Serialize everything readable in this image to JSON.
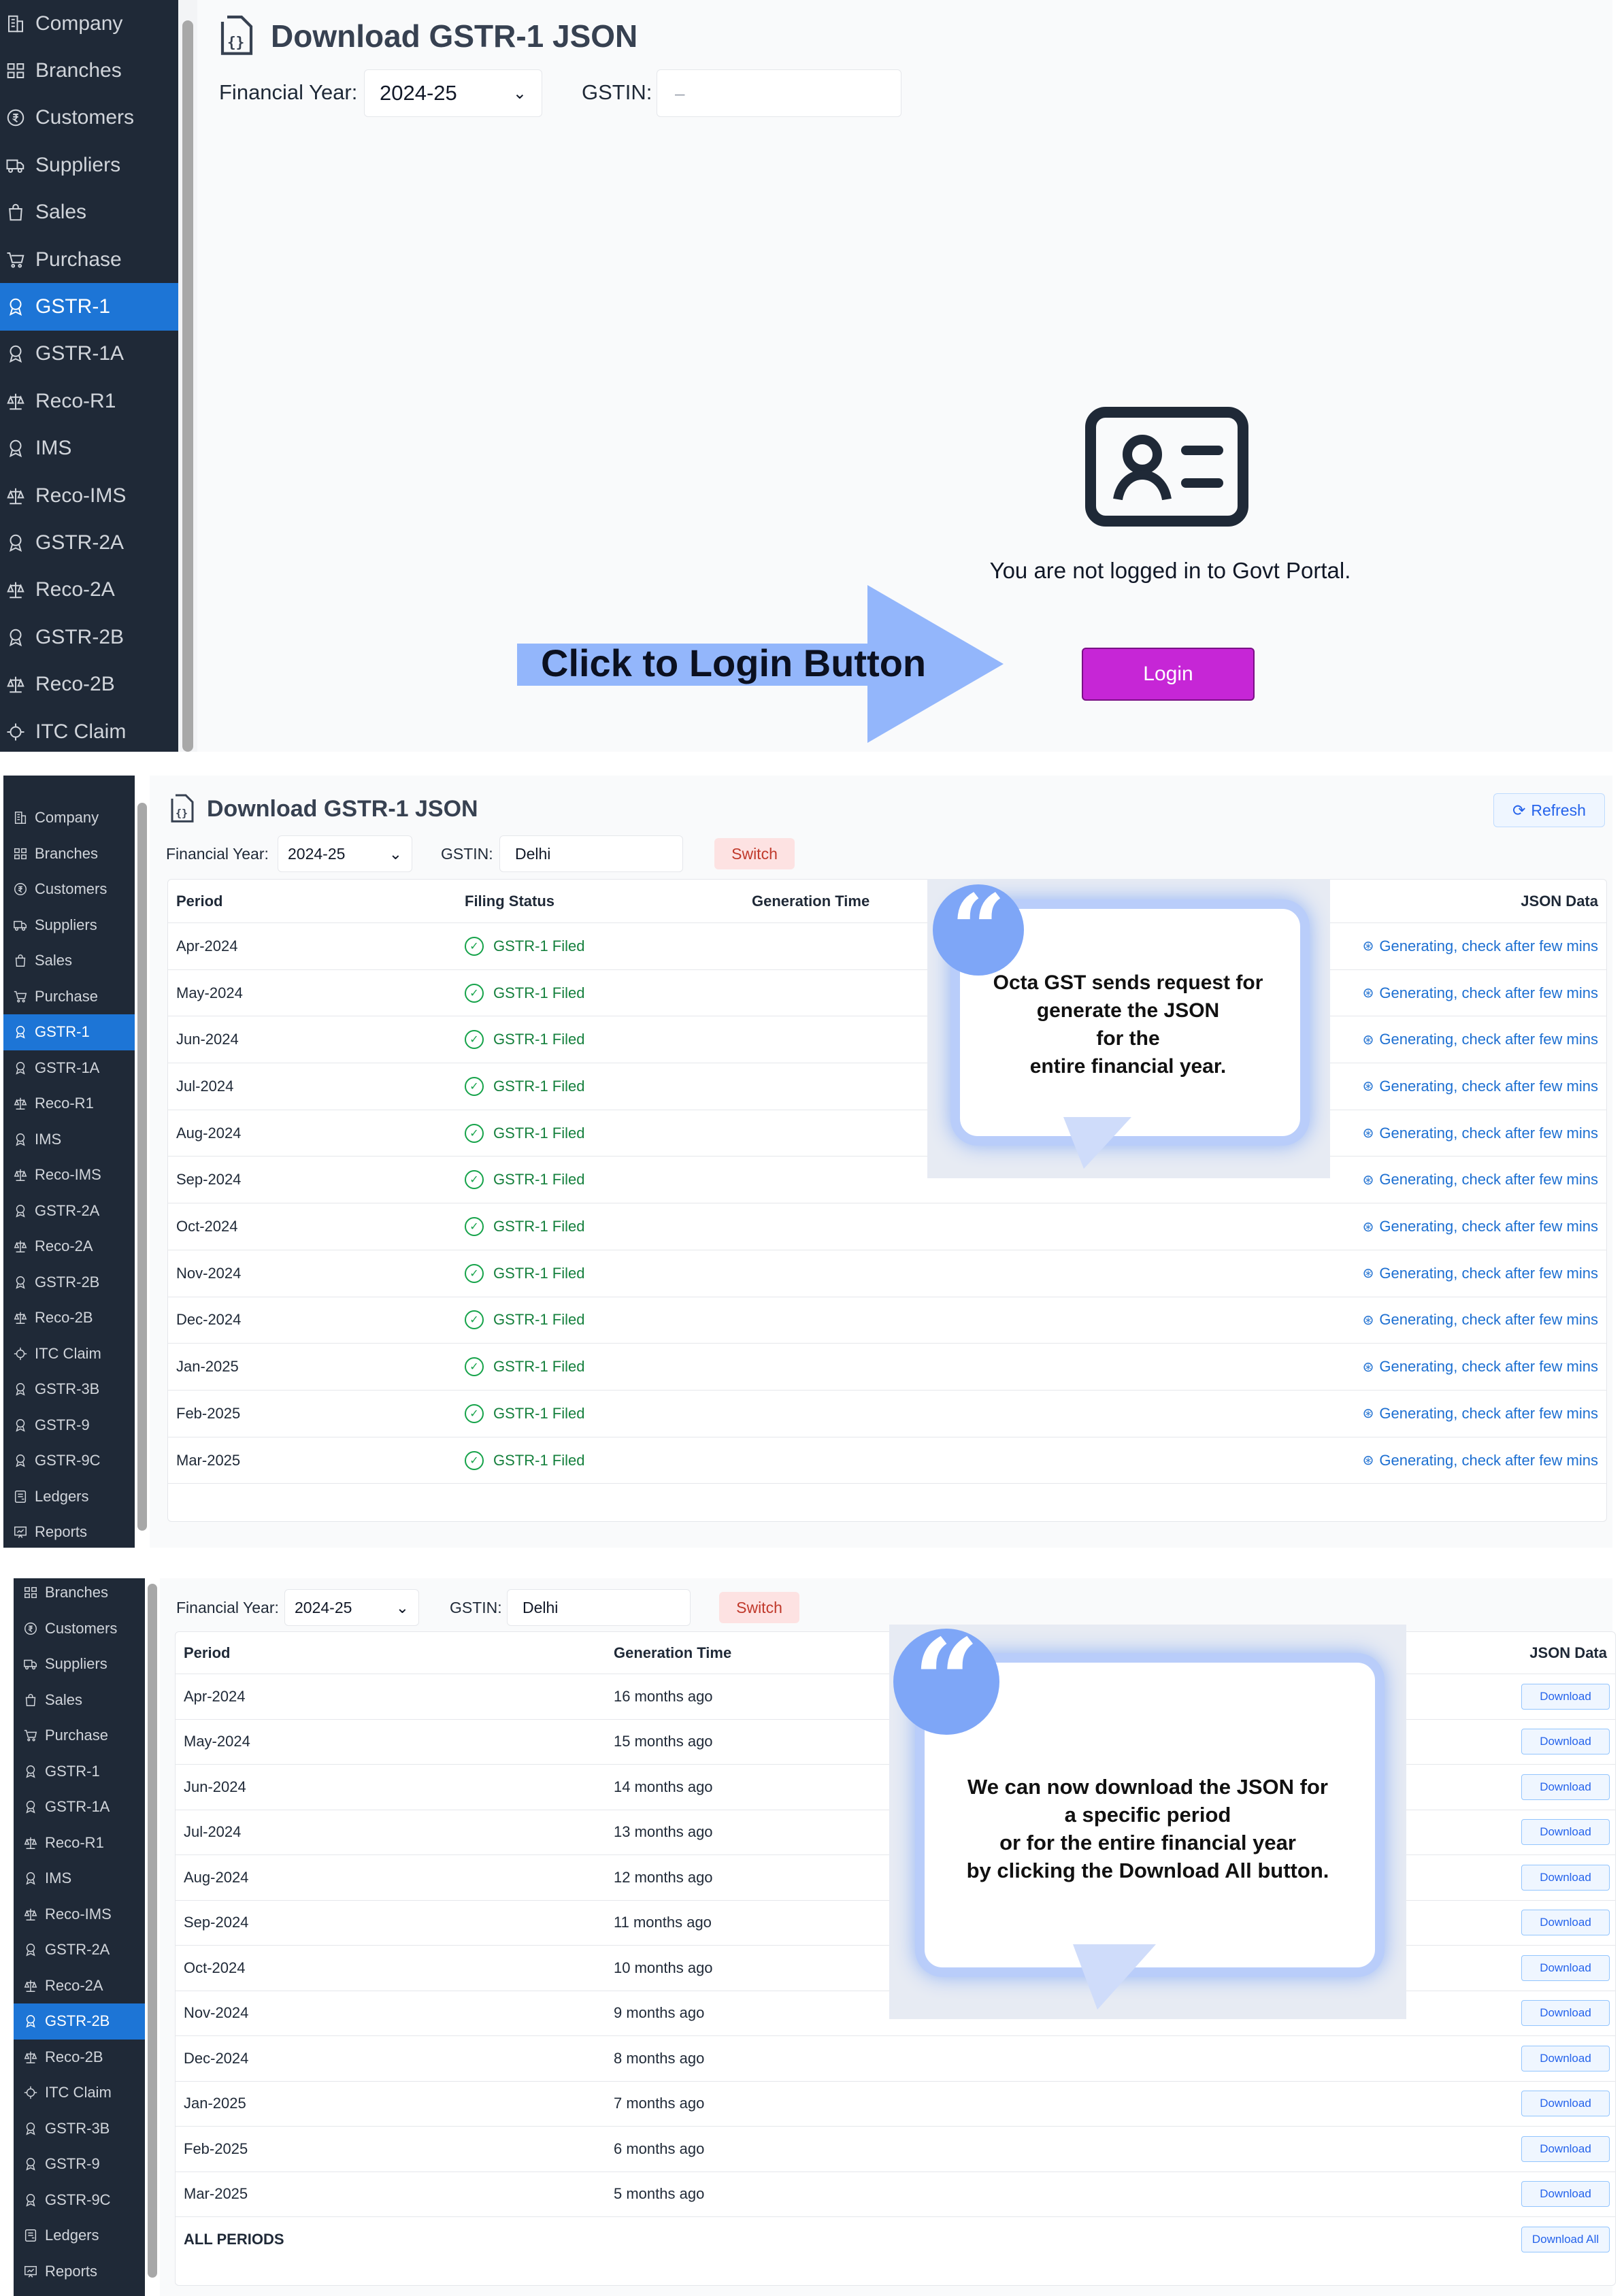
{
  "panel1": {
    "sidebar": [
      "Company",
      "Branches",
      "Customers",
      "Suppliers",
      "Sales",
      "Purchase",
      "GSTR-1",
      "GSTR-1A",
      "Reco-R1",
      "IMS",
      "Reco-IMS",
      "GSTR-2A",
      "Reco-2A",
      "GSTR-2B",
      "Reco-2B",
      "ITC Claim"
    ],
    "active": "GSTR-1",
    "title": "Download GSTR-1 JSON",
    "fy_label": "Financial Year:",
    "fy_value": "2024-25",
    "gstin_label": "GSTIN:",
    "gstin_placeholder": "–",
    "not_logged": "You are not logged in to Govt Portal.",
    "login": "Login",
    "callout": "Click to Login Button"
  },
  "panel2": {
    "sidebar": [
      "Company",
      "Branches",
      "Customers",
      "Suppliers",
      "Sales",
      "Purchase",
      "GSTR-1",
      "GSTR-1A",
      "Reco-R1",
      "IMS",
      "Reco-IMS",
      "GSTR-2A",
      "Reco-2A",
      "GSTR-2B",
      "Reco-2B",
      "ITC Claim",
      "GSTR-3B",
      "GSTR-9",
      "GSTR-9C",
      "Ledgers",
      "Reports"
    ],
    "active": "GSTR-1",
    "title": "Download GSTR-1 JSON",
    "refresh": "Refresh",
    "fy_label": "Financial Year:",
    "fy_value": "2024-25",
    "gstin_label": "GSTIN:",
    "gstin_value": "Delhi",
    "switch": "Switch",
    "headers": {
      "period": "Period",
      "status": "Filing Status",
      "gen": "Generation Time",
      "json": "JSON Data"
    },
    "rows": [
      {
        "period": "Apr-2024",
        "status": "GSTR-1 Filed",
        "json": "Generating, check after few mins"
      },
      {
        "period": "May-2024",
        "status": "GSTR-1 Filed",
        "json": "Generating, check after few mins"
      },
      {
        "period": "Jun-2024",
        "status": "GSTR-1 Filed",
        "json": "Generating, check after few mins"
      },
      {
        "period": "Jul-2024",
        "status": "GSTR-1 Filed",
        "json": "Generating, check after few mins"
      },
      {
        "period": "Aug-2024",
        "status": "GSTR-1 Filed",
        "json": "Generating, check after few mins"
      },
      {
        "period": "Sep-2024",
        "status": "GSTR-1 Filed",
        "json": "Generating, check after few mins"
      },
      {
        "period": "Oct-2024",
        "status": "GSTR-1 Filed",
        "json": "Generating, check after few mins"
      },
      {
        "period": "Nov-2024",
        "status": "GSTR-1 Filed",
        "json": "Generating, check after few mins"
      },
      {
        "period": "Dec-2024",
        "status": "GSTR-1 Filed",
        "json": "Generating, check after few mins"
      },
      {
        "period": "Jan-2025",
        "status": "GSTR-1 Filed",
        "json": "Generating, check after few mins"
      },
      {
        "period": "Feb-2025",
        "status": "GSTR-1 Filed",
        "json": "Generating, check after few mins"
      },
      {
        "period": "Mar-2025",
        "status": "GSTR-1 Filed",
        "json": "Generating, check after few mins"
      }
    ],
    "bubble": [
      "Octa GST sends  request for",
      "generate the JSON",
      "for the",
      "entire financial year."
    ]
  },
  "panel3": {
    "sidebar": [
      "Branches",
      "Customers",
      "Suppliers",
      "Sales",
      "Purchase",
      "GSTR-1",
      "GSTR-1A",
      "Reco-R1",
      "IMS",
      "Reco-IMS",
      "GSTR-2A",
      "Reco-2A",
      "GSTR-2B",
      "Reco-2B",
      "ITC Claim",
      "GSTR-3B",
      "GSTR-9",
      "GSTR-9C",
      "Ledgers",
      "Reports"
    ],
    "active": "GSTR-2B",
    "fy_label": "Financial Year:",
    "fy_value": "2024-25",
    "gstin_label": "GSTIN:",
    "gstin_value": "Delhi",
    "switch": "Switch",
    "headers": {
      "period": "Period",
      "gen": "Generation Time",
      "json": "JSON Data"
    },
    "rows": [
      {
        "period": "Apr-2024",
        "gen": "16 months ago",
        "action": "Download"
      },
      {
        "period": "May-2024",
        "gen": "15 months ago",
        "action": "Download"
      },
      {
        "period": "Jun-2024",
        "gen": "14 months ago",
        "action": "Download"
      },
      {
        "period": "Jul-2024",
        "gen": "13 months ago",
        "action": "Download"
      },
      {
        "period": "Aug-2024",
        "gen": "12 months ago",
        "action": "Download"
      },
      {
        "period": "Sep-2024",
        "gen": "11 months ago",
        "action": "Download"
      },
      {
        "period": "Oct-2024",
        "gen": "10 months ago",
        "action": "Download"
      },
      {
        "period": "Nov-2024",
        "gen": "9 months ago",
        "action": "Download"
      },
      {
        "period": "Dec-2024",
        "gen": "8 months ago",
        "action": "Download"
      },
      {
        "period": "Jan-2025",
        "gen": "7 months ago",
        "action": "Download"
      },
      {
        "period": "Feb-2025",
        "gen": "6 months ago",
        "action": "Download"
      },
      {
        "period": "Mar-2025",
        "gen": "5 months ago",
        "action": "Download"
      }
    ],
    "all_periods": "ALL PERIODS",
    "download_all": "Download All",
    "bubble": [
      "We can now download the JSON for",
      "a specific period",
      "or for the entire financial year",
      "by clicking the Download All button."
    ]
  }
}
